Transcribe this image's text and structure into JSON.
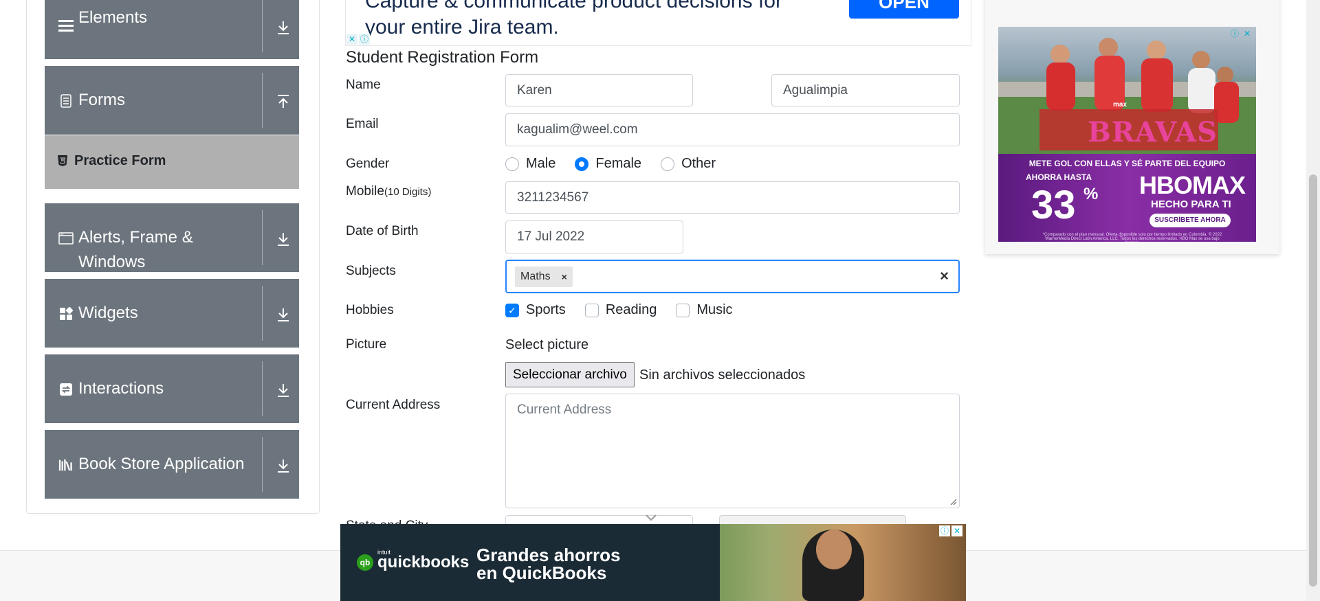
{
  "sidebar": {
    "groups": [
      {
        "label": "Elements",
        "icon": "hamburger-icon",
        "arrow": "download-arrow-icon"
      },
      {
        "label": "Forms",
        "icon": "document-icon",
        "arrow": "upload-arrow-icon"
      },
      {
        "label_line1": "Alerts, Frame &",
        "label_line2": "Windows",
        "icon": "window-icon",
        "arrow": "download-arrow-icon"
      },
      {
        "label": "Widgets",
        "icon": "widgets-icon",
        "arrow": "download-arrow-icon"
      },
      {
        "label": "Interactions",
        "icon": "interactions-icon",
        "arrow": "download-arrow-icon"
      },
      {
        "label": "Book Store Application",
        "icon": "books-icon",
        "arrow": "download-arrow-icon"
      }
    ],
    "active_item": {
      "label": "Practice Form",
      "icon": "html5-icon"
    },
    "colors": {
      "group_bg": "#6c757d",
      "active_bg": "#b0b0b0"
    }
  },
  "top_ad": {
    "headline_line1": "Capture & communicate product decisions for",
    "headline_line2": "your entire Jira team.",
    "button": "OPEN",
    "button_color": "#0065ff"
  },
  "form": {
    "title": "Student Registration Form",
    "name_label": "Name",
    "first_name": "Karen",
    "last_name": "Agualimpia",
    "email_label": "Email",
    "email": "kagualim@weel.com",
    "gender_label": "Gender",
    "genders": [
      {
        "label": "Male",
        "checked": false
      },
      {
        "label": "Female",
        "checked": true
      },
      {
        "label": "Other",
        "checked": false
      }
    ],
    "mobile_label": "Mobile",
    "mobile_hint": "(10 Digits)",
    "mobile": "3211234567",
    "dob_label": "Date of Birth",
    "dob": "17 Jul 2022",
    "subjects_label": "Subjects",
    "subjects": [
      "Maths"
    ],
    "chip_remove": "×",
    "clear_symbol": "×",
    "hobbies_label": "Hobbies",
    "hobbies": [
      {
        "label": "Sports",
        "checked": true
      },
      {
        "label": "Reading",
        "checked": false
      },
      {
        "label": "Music",
        "checked": false
      }
    ],
    "picture_label": "Picture",
    "select_picture": "Select picture",
    "file_button": "Seleccionar archivo",
    "file_status": "Sin archivos seleccionados",
    "address_label": "Current Address",
    "address_placeholder": "Current Address",
    "state_city_label": "State and City",
    "accent_color": "#007bff",
    "focus_color": "#2684ff"
  },
  "right_ad": {
    "brand_small": "max",
    "title": "BRAVAS",
    "tagline": "METE GOL CON ELLAS Y SÉ PARTE DEL EQUIPO",
    "upto": "AHORRA HASTA",
    "discount": "33",
    "percent": "%",
    "logo": "HBOMAX",
    "slogan": "HECHO PARA TI",
    "cta": "SUSCRÍBETE AHORA",
    "fine_print": "*Comparado con el plan mensual. Oferta disponible solo por tiempo limitado en Colombia. © 2022 WarnerMedia Direct Latin America, LLC. Todos los derechos reservados. HBO Max se usa bajo licencia."
  },
  "bottom_ad": {
    "brand_intuit": "intuit",
    "brand": "quickbooks",
    "brand_mark": "qb",
    "headline": "Grandes ahorros\nen QuickBooks"
  },
  "ad_badge": {
    "close": "✕",
    "info": "ⓘ"
  }
}
